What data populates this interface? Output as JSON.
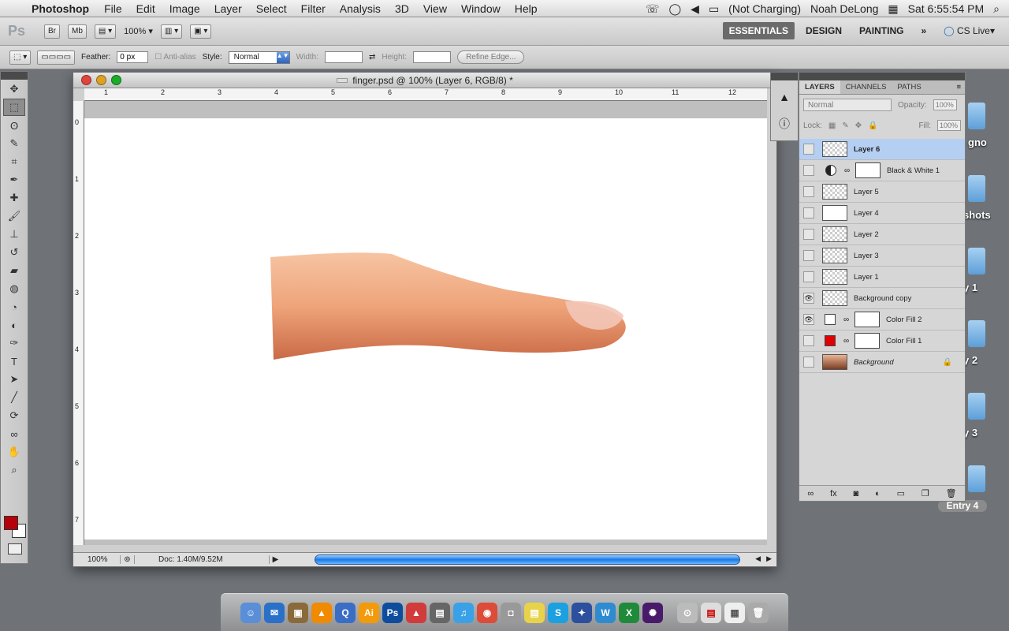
{
  "menubar": {
    "app_name": "Photoshop",
    "items": [
      "File",
      "Edit",
      "Image",
      "Layer",
      "Select",
      "Filter",
      "Analysis",
      "3D",
      "View",
      "Window",
      "Help"
    ],
    "battery": "(Not Charging)",
    "user": "Noah DeLong",
    "clock": "Sat 6:55:54 PM"
  },
  "appbar": {
    "logo": "Ps",
    "br": "Br",
    "mb": "Mb",
    "zoom": "100%",
    "workspaces": [
      "ESSENTIALS",
      "DESIGN",
      "PAINTING"
    ],
    "more": "»",
    "cs_live": "CS Live"
  },
  "options": {
    "feather_label": "Feather:",
    "feather_value": "0 px",
    "antialias_label": "Anti-alias",
    "style_label": "Style:",
    "style_value": "Normal",
    "width_label": "Width:",
    "height_label": "Height:",
    "refine": "Refine Edge..."
  },
  "document": {
    "title": "finger.psd @ 100% (Layer 6, RGB/8) *",
    "zoom": "100%",
    "doc_size": "Doc: 1.40M/9.52M",
    "ruler_h": [
      "1",
      "2",
      "3",
      "4",
      "5",
      "6",
      "7",
      "8",
      "9",
      "10",
      "11",
      "12"
    ],
    "ruler_v": [
      "0",
      "1",
      "2",
      "3",
      "4",
      "5",
      "6",
      "7"
    ]
  },
  "layers_panel": {
    "tabs": [
      "LAYERS",
      "CHANNELS",
      "PATHS"
    ],
    "blend_mode": "Normal",
    "opacity_label": "Opacity:",
    "opacity": "100%",
    "lock_label": "Lock:",
    "fill_label": "Fill:",
    "fill": "100%",
    "layers": [
      {
        "name": "Layer 6",
        "kind": "pixel",
        "visible": false,
        "selected": true
      },
      {
        "name": "Black & White 1",
        "kind": "adjustment",
        "visible": false
      },
      {
        "name": "Layer 5",
        "kind": "pixel",
        "visible": false
      },
      {
        "name": "Layer 4",
        "kind": "pixel",
        "visible": false
      },
      {
        "name": "Layer 2",
        "kind": "pixel",
        "visible": false
      },
      {
        "name": "Layer 3",
        "kind": "pixel",
        "visible": false
      },
      {
        "name": "Layer 1",
        "kind": "pixel",
        "visible": false
      },
      {
        "name": "Background copy",
        "kind": "pixel",
        "visible": true
      },
      {
        "name": "Color Fill 2",
        "kind": "fill",
        "color": "#ffffff",
        "visible": true
      },
      {
        "name": "Color Fill 1",
        "kind": "fill",
        "color": "#e00000",
        "visible": false
      },
      {
        "name": "Background",
        "kind": "background",
        "visible": false,
        "locked": true
      }
    ]
  },
  "desktop": {
    "labels": [
      "gno",
      "shots",
      "y 1",
      "y 2",
      "y 3",
      "Entry 4"
    ]
  },
  "colors": {
    "foreground": "#b6000a",
    "background": "#ffffff",
    "selection": "#b5cff3"
  }
}
